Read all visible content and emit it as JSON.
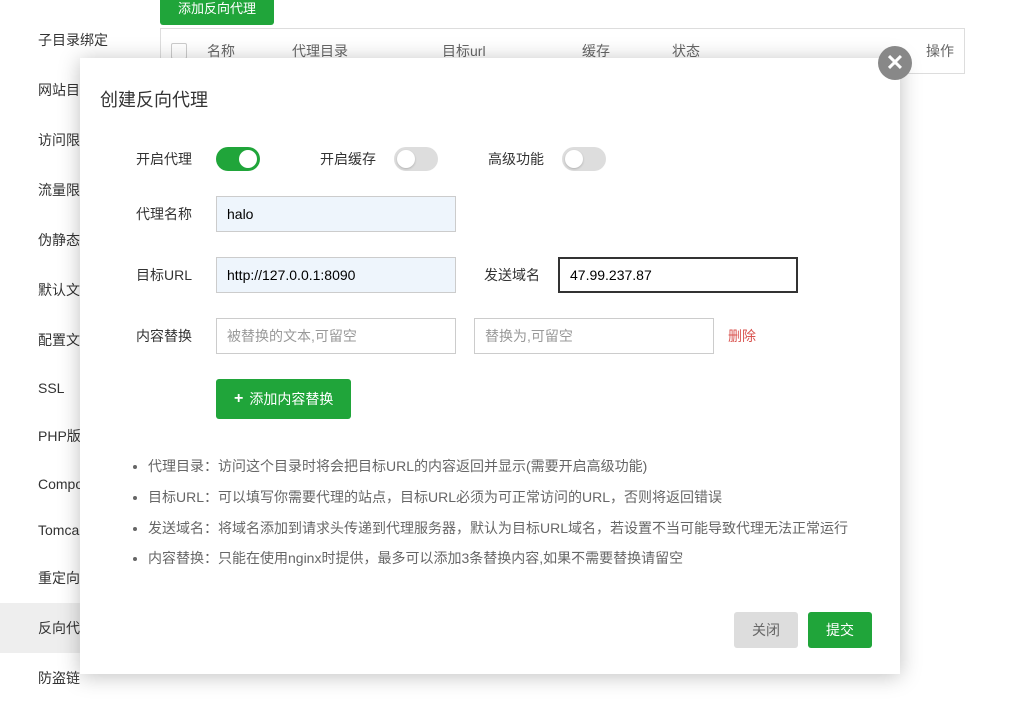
{
  "sidebar": {
    "items": [
      {
        "label": "子目录绑定"
      },
      {
        "label": "网站目"
      },
      {
        "label": "访问限"
      },
      {
        "label": "流量限"
      },
      {
        "label": "伪静态"
      },
      {
        "label": "默认文"
      },
      {
        "label": "配置文"
      },
      {
        "label": "SSL"
      },
      {
        "label": "PHP版"
      },
      {
        "label": "Compo"
      },
      {
        "label": "Tomca"
      },
      {
        "label": "重定向"
      },
      {
        "label": "反向代",
        "active": true
      },
      {
        "label": "防盗链"
      }
    ]
  },
  "main": {
    "top_button": "添加反向代理",
    "table": {
      "headers": {
        "name": "名称",
        "dir": "代理目录",
        "url": "目标url",
        "cache": "缓存",
        "status": "状态",
        "op": "操作"
      }
    }
  },
  "modal": {
    "title": "创建反向代理",
    "toggles": {
      "enable_proxy": "开启代理",
      "enable_cache": "开启缓存",
      "advanced": "高级功能"
    },
    "labels": {
      "proxy_name": "代理名称",
      "target_url": "目标URL",
      "send_domain": "发送域名",
      "content_replace": "内容替换"
    },
    "values": {
      "proxy_name": "halo",
      "target_url": "http://127.0.0.1:8090",
      "send_domain": "47.99.237.87"
    },
    "placeholders": {
      "replace_from": "被替换的文本,可留空",
      "replace_to": "替换为,可留空"
    },
    "delete_link": "删除",
    "add_replace_btn": "添加内容替换",
    "help": [
      "代理目录：访问这个目录时将会把目标URL的内容返回并显示(需要开启高级功能)",
      "目标URL：可以填写你需要代理的站点，目标URL必须为可正常访问的URL，否则将返回错误",
      "发送域名：将域名添加到请求头传递到代理服务器，默认为目标URL域名，若设置不当可能导致代理无法正常运行",
      "内容替换：只能在使用nginx时提供，最多可以添加3条替换内容,如果不需要替换请留空"
    ],
    "buttons": {
      "cancel": "关闭",
      "submit": "提交"
    }
  }
}
